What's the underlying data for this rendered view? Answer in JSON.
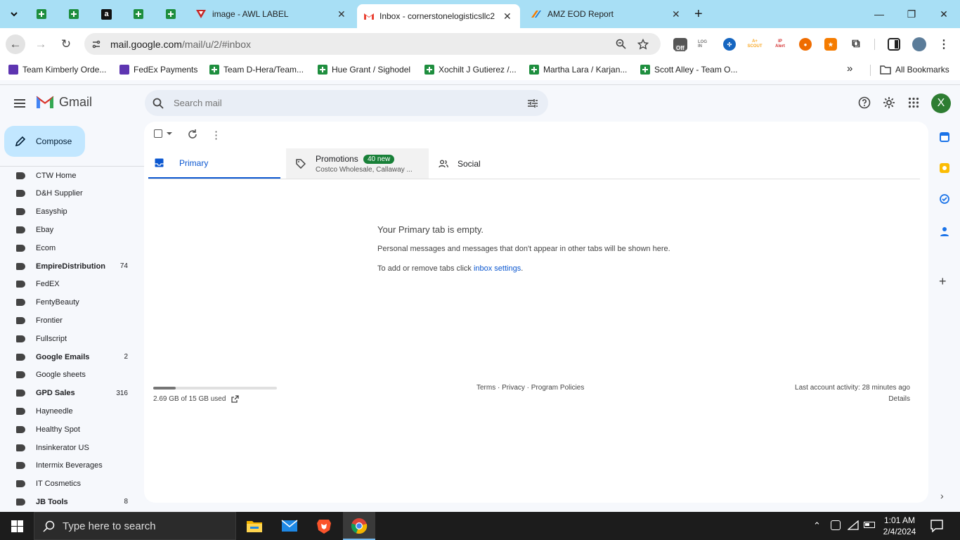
{
  "browser": {
    "tabs": [
      {
        "title": "image - AWL LABEL"
      },
      {
        "title": "Inbox - cornerstonelogisticsllc2"
      },
      {
        "title": "AMZ EOD Report"
      }
    ],
    "url_host": "mail.google.com",
    "url_path": "/mail/u/2/#inbox",
    "ext_off_badge": "Off",
    "ext_labels": {
      "scout": "A+ SCOUT",
      "ip": "IP Alert",
      "login": "LOG IN"
    }
  },
  "bookmarks": {
    "items": [
      {
        "label": "Team Kimberly Orde..."
      },
      {
        "label": "FedEx Payments"
      },
      {
        "label": "Team D-Hera/Team..."
      },
      {
        "label": "Hue Grant / Sighodel"
      },
      {
        "label": "Xochilt J Gutierez /..."
      },
      {
        "label": "Martha Lara / Karjan..."
      },
      {
        "label": "Scott Alley - Team O..."
      }
    ],
    "more": "»",
    "all_bookmarks": "All Bookmarks"
  },
  "gmail": {
    "logo_text": "Gmail",
    "search_placeholder": "Search mail",
    "avatar_letter": "X",
    "compose_label": "Compose",
    "labels": [
      {
        "name": "CTW Home",
        "count": "",
        "bold": false
      },
      {
        "name": "D&H Supplier",
        "count": "",
        "bold": false
      },
      {
        "name": "Easyship",
        "count": "",
        "bold": false
      },
      {
        "name": "Ebay",
        "count": "",
        "bold": false
      },
      {
        "name": "Ecom",
        "count": "",
        "bold": false
      },
      {
        "name": "EmpireDistribution",
        "count": "74",
        "bold": true
      },
      {
        "name": "FedEX",
        "count": "",
        "bold": false
      },
      {
        "name": "FentyBeauty",
        "count": "",
        "bold": false
      },
      {
        "name": "Frontier",
        "count": "",
        "bold": false
      },
      {
        "name": "Fullscript",
        "count": "",
        "bold": false
      },
      {
        "name": "Google Emails",
        "count": "2",
        "bold": true
      },
      {
        "name": "Google sheets",
        "count": "",
        "bold": false
      },
      {
        "name": "GPD Sales",
        "count": "316",
        "bold": true
      },
      {
        "name": "Hayneedle",
        "count": "",
        "bold": false
      },
      {
        "name": "Healthy Spot",
        "count": "",
        "bold": false
      },
      {
        "name": "Insinkerator US",
        "count": "",
        "bold": false
      },
      {
        "name": "Intermix Beverages",
        "count": "",
        "bold": false
      },
      {
        "name": "IT Cosmetics",
        "count": "",
        "bold": false
      },
      {
        "name": "JB Tools",
        "count": "8",
        "bold": true
      }
    ],
    "tabs": {
      "primary": "Primary",
      "promotions": "Promotions",
      "promotions_badge": "40 new",
      "promotions_snippet": "Costco Wholesale, Callaway ...",
      "social": "Social"
    },
    "empty": {
      "heading": "Your Primary tab is empty.",
      "line1": "Personal messages and messages that don't appear in other tabs will be shown here.",
      "line2_prefix": "To add or remove tabs click ",
      "line2_link": "inbox settings",
      "line2_suffix": "."
    },
    "footer": {
      "storage": "2.69 GB of 15 GB used",
      "storage_fraction": 0.18,
      "links": "Terms · Privacy · Program Policies",
      "activity": "Last account activity: 28 minutes ago",
      "details": "Details"
    }
  },
  "taskbar": {
    "search_placeholder": "Type here to search",
    "time": "1:01 AM",
    "date": "2/4/2024"
  }
}
